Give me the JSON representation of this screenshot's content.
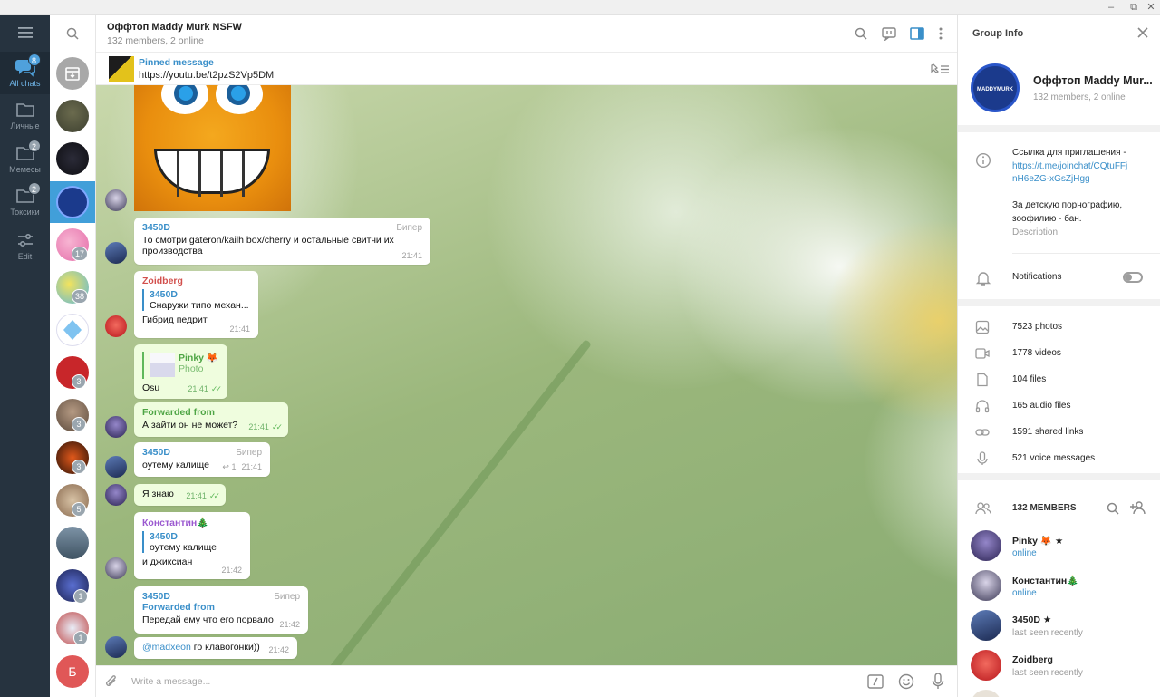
{
  "window": {
    "minimize": "–",
    "restore": "⧉",
    "close": "✕"
  },
  "folders": [
    {
      "label": "All chats",
      "badge": "8",
      "icon": "chats-icon"
    },
    {
      "label": "Личные",
      "badge": "",
      "icon": "folder-icon"
    },
    {
      "label": "Мемесы",
      "badge": "2",
      "icon": "folder-icon"
    },
    {
      "label": "Токсики",
      "badge": "2",
      "icon": "folder-icon"
    },
    {
      "label": "Edit",
      "badge": "",
      "icon": "sliders-icon"
    }
  ],
  "chat_list": {
    "badges": [
      "17",
      "38",
      "3",
      "3",
      "3",
      "5",
      "1",
      "1"
    ],
    "last_avatar_letter": "Б"
  },
  "header": {
    "title": "Оффтоп Maddy Murk NSFW",
    "subtitle": "132 members, 2 online"
  },
  "pinned": {
    "title": "Pinned message",
    "text": "https://youtu.be/t2pzS2Vp5DM"
  },
  "messages": [
    {
      "sender": "3450D",
      "badge": "Бипер",
      "text": "То смотри gateron/kailh box/cherry и остальные свитчи их производства",
      "time": "21:41"
    },
    {
      "sender": "Zoidberg",
      "reply_name": "3450D",
      "reply_text": "Снаружи типо механ...",
      "text": "Гибрид педрит",
      "time": "21:41"
    },
    {
      "reply_name": "Pinky 🦊",
      "reply_text": "Photo",
      "text": "Osu",
      "time": "21:41"
    },
    {
      "sender": "Forwarded from",
      "text": "А зайти он не может?",
      "time": "21:41"
    },
    {
      "sender": "3450D",
      "badge": "Бипер",
      "text": "оутему калище",
      "replies": "↩ 1",
      "time": "21:41"
    },
    {
      "text": "Я знаю",
      "time": "21:41"
    },
    {
      "sender": "Константин🎄",
      "reply_name": "3450D",
      "reply_text": "оутему калище",
      "text": "и джиксиан",
      "time": "21:42"
    },
    {
      "sender": "3450D",
      "badge": "Бипер",
      "forwarded": "Forwarded from",
      "text": "Передай ему что его порвало",
      "time": "21:42"
    },
    {
      "mention": "@madxeon",
      "text": " го клавогонки))",
      "time": "21:42"
    }
  ],
  "composer": {
    "placeholder": "Write a message..."
  },
  "group_info": {
    "title": "Group Info",
    "name": "Оффтоп Maddy Mur...",
    "avatar_text": "MADDYMURK",
    "members_online": "132 members, 2 online",
    "invite_label": "Ссылка для приглашения -",
    "invite_link_1": "https://t.me/joinchat/CQtuFFj",
    "invite_link_2": "nH6eZG-xGsZjHgg",
    "desc_1": "За детскую порнографию,",
    "desc_2": "зоофилию - бан.",
    "desc_label": "Description",
    "notifications": "Notifications",
    "media": [
      {
        "icon": "photo-icon",
        "label": "7523 photos"
      },
      {
        "icon": "video-icon",
        "label": "1778 videos"
      },
      {
        "icon": "file-icon",
        "label": "104 files"
      },
      {
        "icon": "headphones-icon",
        "label": "165 audio files"
      },
      {
        "icon": "link-icon",
        "label": "1591 shared links"
      },
      {
        "icon": "microphone-icon",
        "label": "521 voice messages"
      }
    ],
    "members_title": "132 MEMBERS",
    "members": [
      {
        "name": "Pinky 🦊 ★",
        "status": "online",
        "online": true
      },
      {
        "name": "Константин🎄",
        "status": "online",
        "online": true
      },
      {
        "name": "3450D ★",
        "status": "last seen recently",
        "online": false
      },
      {
        "name": "Zoidberg",
        "status": "last seen recently",
        "online": false
      }
    ]
  },
  "colors": {
    "accent": "#419fd9",
    "sidebar": "#26333f",
    "outgoing_bubble": "#effdde"
  }
}
